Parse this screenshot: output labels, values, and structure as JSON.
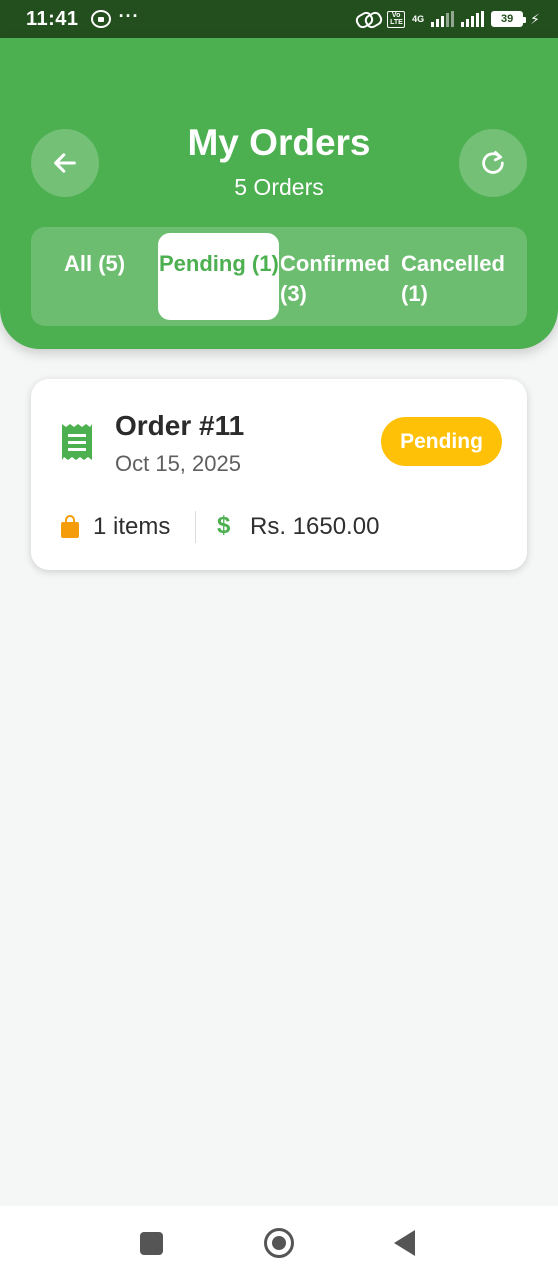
{
  "status_bar": {
    "time": "11:41",
    "more": "···",
    "volte": [
      "Vo",
      "LTE"
    ],
    "network": "4G",
    "battery": "39",
    "bolt": "⚡"
  },
  "header": {
    "title": "My Orders",
    "subtitle": "5 Orders",
    "background_color": "#4caf50"
  },
  "tabs": [
    {
      "label": "All (5)",
      "active": false
    },
    {
      "label": "Pending (1)",
      "active": true
    },
    {
      "label": "Confirmed (3)",
      "active": false
    },
    {
      "label": "Cancelled (1)",
      "active": false
    }
  ],
  "orders": [
    {
      "number": "Order #11",
      "date": "Oct 15, 2025",
      "status": "Pending",
      "status_color": "#ffc107",
      "items": "1 items",
      "currency_symbol": "$",
      "total": "Rs. 1650.00"
    }
  ],
  "icons": {
    "back": "arrow-left-icon",
    "refresh": "refresh-icon",
    "order": "receipt-icon",
    "items": "shopping-bag-icon",
    "total": "dollar-icon"
  }
}
